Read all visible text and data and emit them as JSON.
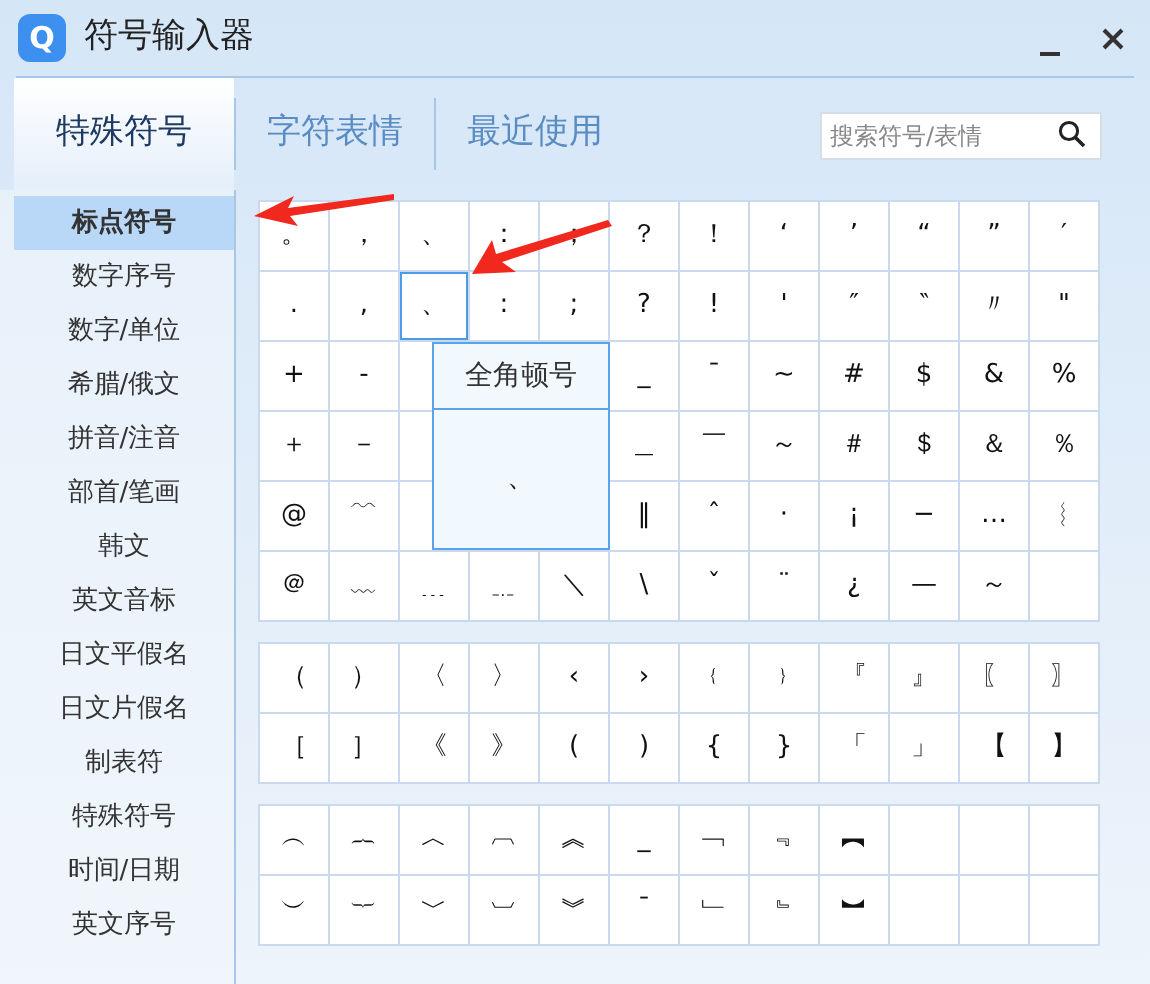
{
  "window": {
    "logo": "Q",
    "title": "符号输入器"
  },
  "tabs": [
    {
      "label": "特殊符号",
      "selected": true
    },
    {
      "label": "字符表情",
      "selected": false
    },
    {
      "label": "最近使用",
      "selected": false
    }
  ],
  "search": {
    "placeholder": "搜索符号/表情"
  },
  "sidebar": {
    "items": [
      {
        "label": "标点符号",
        "selected": true
      },
      {
        "label": "数字序号",
        "selected": false
      },
      {
        "label": "数字/单位",
        "selected": false
      },
      {
        "label": "希腊/俄文",
        "selected": false
      },
      {
        "label": "拼音/注音",
        "selected": false
      },
      {
        "label": "部首/笔画",
        "selected": false
      },
      {
        "label": "韩文",
        "selected": false
      },
      {
        "label": "英文音标",
        "selected": false
      },
      {
        "label": "日文平假名",
        "selected": false
      },
      {
        "label": "日文片假名",
        "selected": false
      },
      {
        "label": "制表符",
        "selected": false
      },
      {
        "label": "特殊符号",
        "selected": false
      },
      {
        "label": "时间/日期",
        "selected": false
      },
      {
        "label": "英文序号",
        "selected": false
      }
    ]
  },
  "symbol_blocks": [
    {
      "rows": [
        [
          {
            "symbol": "。",
            "selected": false
          },
          {
            "symbol": "，",
            "selected": false
          },
          {
            "symbol": "、",
            "selected": false
          },
          {
            "symbol": "：",
            "selected": false
          },
          {
            "symbol": "；",
            "selected": false
          },
          {
            "symbol": "？",
            "selected": false
          },
          {
            "symbol": "！",
            "selected": false
          },
          {
            "symbol": "‘",
            "selected": false
          },
          {
            "symbol": "’",
            "selected": false
          },
          {
            "symbol": "“",
            "selected": false
          },
          {
            "symbol": "”",
            "selected": false
          },
          {
            "symbol": "′",
            "selected": false
          }
        ],
        [
          {
            "symbol": ".",
            "selected": false
          },
          {
            "symbol": ",",
            "selected": false
          },
          {
            "symbol": "、",
            "selected": true
          },
          {
            "symbol": ":",
            "selected": false
          },
          {
            "symbol": ";",
            "selected": false
          },
          {
            "symbol": "?",
            "selected": false
          },
          {
            "symbol": "!",
            "selected": false
          },
          {
            "symbol": "'",
            "selected": false
          },
          {
            "symbol": "″",
            "selected": false
          },
          {
            "symbol": "‶",
            "selected": false
          },
          {
            "symbol": "〃",
            "selected": false
          },
          {
            "symbol": "\"",
            "selected": false
          }
        ],
        [
          {
            "symbol": "+",
            "selected": false
          },
          {
            "symbol": "-",
            "selected": false
          },
          null,
          null,
          null,
          {
            "symbol": "_",
            "selected": false
          },
          {
            "symbol": "¯",
            "selected": false
          },
          {
            "symbol": "~",
            "selected": false
          },
          {
            "symbol": "#",
            "selected": false
          },
          {
            "symbol": "$",
            "selected": false
          },
          {
            "symbol": "&",
            "selected": false
          },
          {
            "symbol": "%",
            "selected": false
          }
        ],
        [
          {
            "symbol": "＋",
            "selected": false
          },
          {
            "symbol": "－",
            "selected": false
          },
          null,
          null,
          null,
          {
            "symbol": "＿",
            "selected": false
          },
          {
            "symbol": "￣",
            "selected": false
          },
          {
            "symbol": "～",
            "selected": false
          },
          {
            "symbol": "＃",
            "selected": false
          },
          {
            "symbol": "＄",
            "selected": false
          },
          {
            "symbol": "＆",
            "selected": false
          },
          {
            "symbol": "％",
            "selected": false
          }
        ],
        [
          {
            "symbol": "@",
            "selected": false
          },
          {
            "symbol": "﹋",
            "selected": false
          },
          null,
          null,
          null,
          {
            "symbol": "‖",
            "selected": false
          },
          {
            "symbol": "ˆ",
            "selected": false
          },
          {
            "symbol": "·",
            "selected": false
          },
          {
            "symbol": "¡",
            "selected": false
          },
          {
            "symbol": "−",
            "selected": false
          },
          {
            "symbol": "…",
            "selected": false
          },
          {
            "symbol": "︴",
            "selected": false
          }
        ],
        [
          {
            "symbol": "＠",
            "selected": false
          },
          {
            "symbol": "﹏",
            "selected": false
          },
          {
            "symbol": "﹍",
            "selected": false
          },
          {
            "symbol": "﹎",
            "selected": false
          },
          {
            "symbol": "＼",
            "selected": false
          },
          {
            "symbol": "\\",
            "selected": false
          },
          {
            "symbol": "ˇ",
            "selected": false
          },
          {
            "symbol": "¨",
            "selected": false
          },
          {
            "symbol": "¿",
            "selected": false
          },
          {
            "symbol": "—",
            "selected": false
          },
          {
            "symbol": "～",
            "selected": false
          },
          null
        ]
      ],
      "tooltip": {
        "title": "全角顿号",
        "preview": "、"
      }
    },
    {
      "rows": [
        [
          {
            "symbol": "（",
            "selected": false
          },
          {
            "symbol": "）",
            "selected": false
          },
          {
            "symbol": "〈",
            "selected": false
          },
          {
            "symbol": "〉",
            "selected": false
          },
          {
            "symbol": "‹",
            "selected": false
          },
          {
            "symbol": "›",
            "selected": false
          },
          {
            "symbol": "﹛",
            "selected": false
          },
          {
            "symbol": "﹜",
            "selected": false
          },
          {
            "symbol": "『",
            "selected": false
          },
          {
            "symbol": "』",
            "selected": false
          },
          {
            "symbol": "〖",
            "selected": false
          },
          {
            "symbol": "〗",
            "selected": false
          }
        ],
        [
          {
            "symbol": "［",
            "selected": false
          },
          {
            "symbol": "］",
            "selected": false
          },
          {
            "symbol": "《",
            "selected": false
          },
          {
            "symbol": "》",
            "selected": false
          },
          {
            "symbol": "(",
            "selected": false
          },
          {
            "symbol": ")",
            "selected": false
          },
          {
            "symbol": "{",
            "selected": false
          },
          {
            "symbol": "}",
            "selected": false
          },
          {
            "symbol": "「",
            "selected": false
          },
          {
            "symbol": "」",
            "selected": false
          },
          {
            "symbol": "【",
            "selected": false
          },
          {
            "symbol": "】",
            "selected": false
          }
        ]
      ]
    },
    {
      "rows": [
        [
          {
            "symbol": "︵",
            "selected": false
          },
          {
            "symbol": "︷",
            "selected": false
          },
          {
            "symbol": "︿",
            "selected": false
          },
          {
            "symbol": "︹",
            "selected": false
          },
          {
            "symbol": "︽",
            "selected": false
          },
          {
            "symbol": "_",
            "selected": false
          },
          {
            "symbol": "﹁",
            "selected": false
          },
          {
            "symbol": "﹃",
            "selected": false
          },
          {
            "symbol": "︻",
            "selected": false
          },
          null,
          null,
          null
        ],
        [
          {
            "symbol": "︶",
            "selected": false
          },
          {
            "symbol": "︸",
            "selected": false
          },
          {
            "symbol": "﹀",
            "selected": false
          },
          {
            "symbol": "︺",
            "selected": false
          },
          {
            "symbol": "︾",
            "selected": false
          },
          {
            "symbol": "ˉ",
            "selected": false
          },
          {
            "symbol": "﹂",
            "selected": false
          },
          {
            "symbol": "﹄",
            "selected": false
          },
          {
            "symbol": "︼",
            "selected": false
          },
          null,
          null,
          null
        ]
      ]
    }
  ]
}
